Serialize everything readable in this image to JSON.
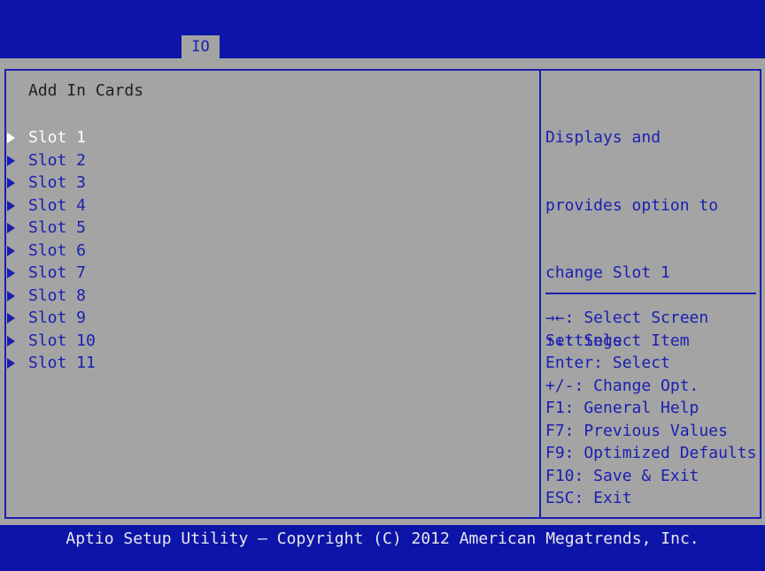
{
  "colors": {
    "background_blue": "#0d14a8",
    "panel_gray": "#a4a4a4",
    "text_blue": "#1a1fb0",
    "selected_text": "#ffffff",
    "footer_text": "#e8e8e8"
  },
  "tabs": {
    "active": "IO"
  },
  "main": {
    "section_title": "Add In Cards",
    "slots": [
      {
        "label": "Slot 1",
        "selected": true
      },
      {
        "label": "Slot 2",
        "selected": false
      },
      {
        "label": "Slot 3",
        "selected": false
      },
      {
        "label": "Slot 4",
        "selected": false
      },
      {
        "label": "Slot 5",
        "selected": false
      },
      {
        "label": "Slot 6",
        "selected": false
      },
      {
        "label": "Slot 7",
        "selected": false
      },
      {
        "label": "Slot 8",
        "selected": false
      },
      {
        "label": "Slot 9",
        "selected": false
      },
      {
        "label": "Slot 10",
        "selected": false
      },
      {
        "label": "Slot 11",
        "selected": false
      }
    ],
    "slot_icon": "submenu-arrow-icon"
  },
  "help": {
    "lines": [
      "Displays and",
      "provides option to",
      "change Slot 1",
      "Settings"
    ]
  },
  "keys": [
    "→←: Select Screen",
    "↑↓: Select Item",
    "Enter: Select",
    "+/-: Change Opt.",
    "F1: General Help",
    "F7: Previous Values",
    "F9: Optimized Defaults",
    "F10: Save & Exit",
    "ESC: Exit"
  ],
  "footer": {
    "copyright": "Aptio Setup Utility – Copyright (C) 2012 American Megatrends, Inc."
  }
}
